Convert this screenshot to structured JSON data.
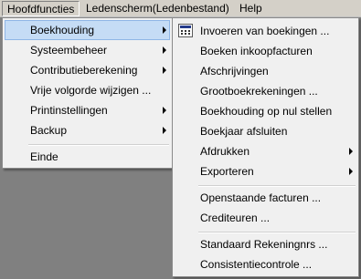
{
  "menubar": {
    "items": [
      {
        "label": "Hoofdfuncties",
        "active": true
      },
      {
        "label": "Ledenscherm(Ledenbestand)",
        "active": false
      },
      {
        "label": "Help",
        "active": false
      }
    ]
  },
  "main_menu": {
    "items": [
      {
        "label": "Boekhouding",
        "submenu": true,
        "highlighted": true
      },
      {
        "label": "Systeembeheer",
        "submenu": true
      },
      {
        "label": "Contributieberekening",
        "submenu": true
      },
      {
        "label": "Vrije volgorde wijzigen ...",
        "submenu": false
      },
      {
        "label": "Printinstellingen",
        "submenu": true
      },
      {
        "label": "Backup",
        "submenu": true
      },
      {
        "label": "Einde",
        "submenu": false
      }
    ]
  },
  "sub_menu": {
    "items": [
      {
        "label": "Invoeren van boekingen ...",
        "icon": "calendar-icon"
      },
      {
        "label": "Boeken inkoopfacturen"
      },
      {
        "label": "Afschrijvingen"
      },
      {
        "label": "Grootboekrekeningen ..."
      },
      {
        "label": "Boekhouding op nul stellen"
      },
      {
        "label": "Boekjaar afsluiten"
      },
      {
        "label": "Afdrukken",
        "submenu": true
      },
      {
        "label": "Exporteren",
        "submenu": true
      },
      {
        "label": "Openstaande facturen ..."
      },
      {
        "label": "Crediteuren ..."
      },
      {
        "label": "Standaard Rekeningnrs ..."
      },
      {
        "label": "Consistentiecontrole ..."
      }
    ]
  },
  "colors": {
    "desktop": "#808080",
    "menubar": "#d4d0c8",
    "menu_bg": "#f0f0f0",
    "highlight": "#c5dcf5"
  }
}
